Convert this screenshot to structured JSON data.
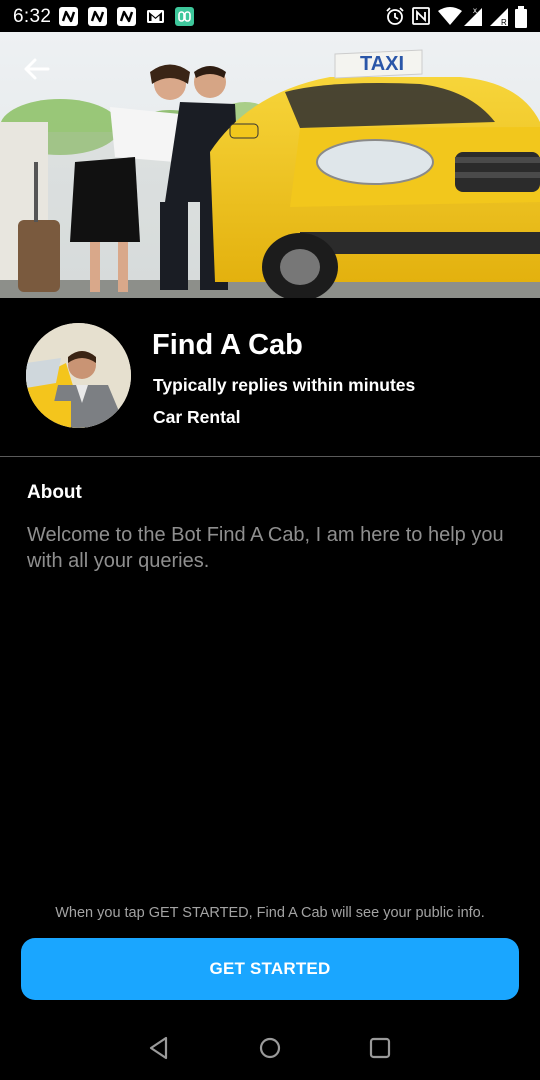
{
  "status_bar": {
    "time": "6:32",
    "icons": [
      "app-n-icon",
      "app-n-icon",
      "app-n-icon",
      "gmail-icon",
      "app-icon",
      "alarm-icon",
      "nfc-icon",
      "wifi-icon",
      "signal-x-icon",
      "signal-r-icon",
      "battery-icon"
    ]
  },
  "header": {
    "photo": "taxi-photo",
    "back_icon": "arrow-left-icon",
    "taxi_sign": "TAXI"
  },
  "profile": {
    "name": "Find A Cab",
    "response_time": "Typically replies within minutes",
    "category": "Car Rental"
  },
  "about": {
    "heading": "About",
    "text": "Welcome to the Bot Find A Cab, I am here to help you with all your queries."
  },
  "footer": {
    "disclaimer": "When you tap GET STARTED, Find A Cab will see your public info.",
    "button_label": "GET STARTED"
  },
  "nav": {
    "back": "triangle-back-icon",
    "home": "circle-home-icon",
    "recents": "square-recents-icon"
  },
  "colors": {
    "accent": "#1aa6ff",
    "background": "#000000",
    "muted_text": "#8f8f8f",
    "taxi_yellow": "#f3c51f"
  }
}
